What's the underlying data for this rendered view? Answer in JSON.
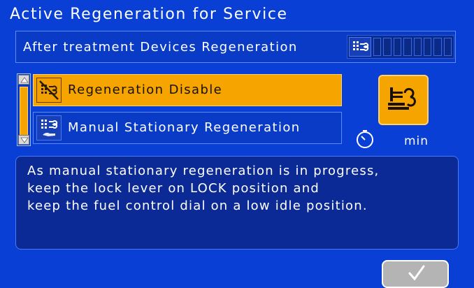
{
  "screen": {
    "title": "Active Regeneration for Service"
  },
  "after_treatment": {
    "label": "After treatment Devices Regeneration",
    "dpf_icon": "dpf-exhaust-icon",
    "level_bar_segments": 8,
    "level_fill": 0
  },
  "menu": {
    "items": [
      {
        "label": "Regeneration Disable",
        "icon": "regeneration-disable-icon",
        "selected": true
      },
      {
        "label": "Manual Stationary Regeneration",
        "icon": "manual-regeneration-icon",
        "selected": false
      }
    ]
  },
  "status": {
    "button_icon": "exhaust-regeneration-icon",
    "timer_icon": "timer-icon",
    "timer_unit": "min"
  },
  "message": {
    "lines": [
      "As manual stationary regeneration is in progress,",
      "keep the lock lever on LOCK position and",
      "keep the fuel control dial on a low idle position."
    ]
  },
  "ok_button": {
    "icon": "checkmark-icon"
  },
  "colors": {
    "background": "#0a3fd6",
    "highlight": "#f5a400",
    "panel": "#0b2a95"
  }
}
